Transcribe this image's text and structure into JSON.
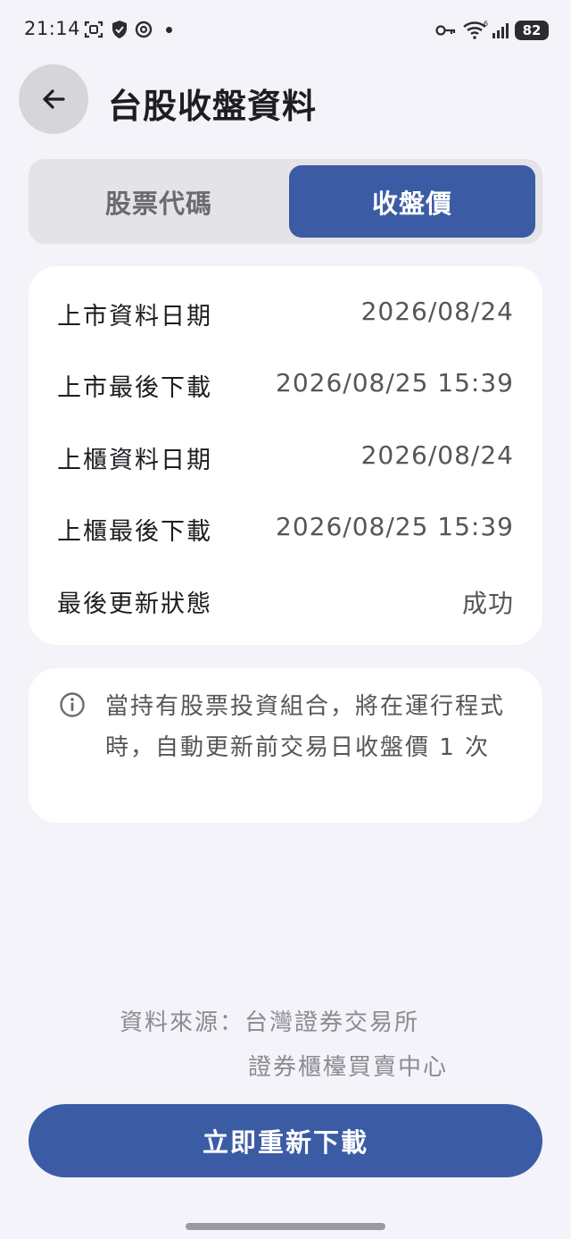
{
  "status_bar": {
    "time": "21:14",
    "battery": "82",
    "icons": [
      "screenshot-icon",
      "shield-icon",
      "threads-icon",
      "dot",
      "key-icon",
      "wifi-icon",
      "signal-icon"
    ]
  },
  "header": {
    "title": "台股收盤資料"
  },
  "tabs": [
    {
      "label": "股票代碼",
      "selected": false
    },
    {
      "label": "收盤價",
      "selected": true
    }
  ],
  "info": {
    "rows": [
      {
        "label": "上市資料日期",
        "value": "2026/08/24"
      },
      {
        "label": "上市最後下載",
        "value": "2026/08/25 15:39"
      },
      {
        "label": "上櫃資料日期",
        "value": "2026/08/24"
      },
      {
        "label": "上櫃最後下載",
        "value": "2026/08/25 15:39"
      },
      {
        "label": "最後更新狀態",
        "value": "成功"
      }
    ]
  },
  "note": {
    "text": "當持有股票投資組合，將在運行程式時，自動更新前交易日收盤價 1 次"
  },
  "source": {
    "line1": "資料來源：台灣證券交易所",
    "line2": "證券櫃檯買賣中心"
  },
  "actions": {
    "reload_label": "立即重新下載"
  },
  "colors": {
    "accent": "#3b5ba5",
    "background": "#f3f3f9",
    "card": "#ffffff"
  }
}
